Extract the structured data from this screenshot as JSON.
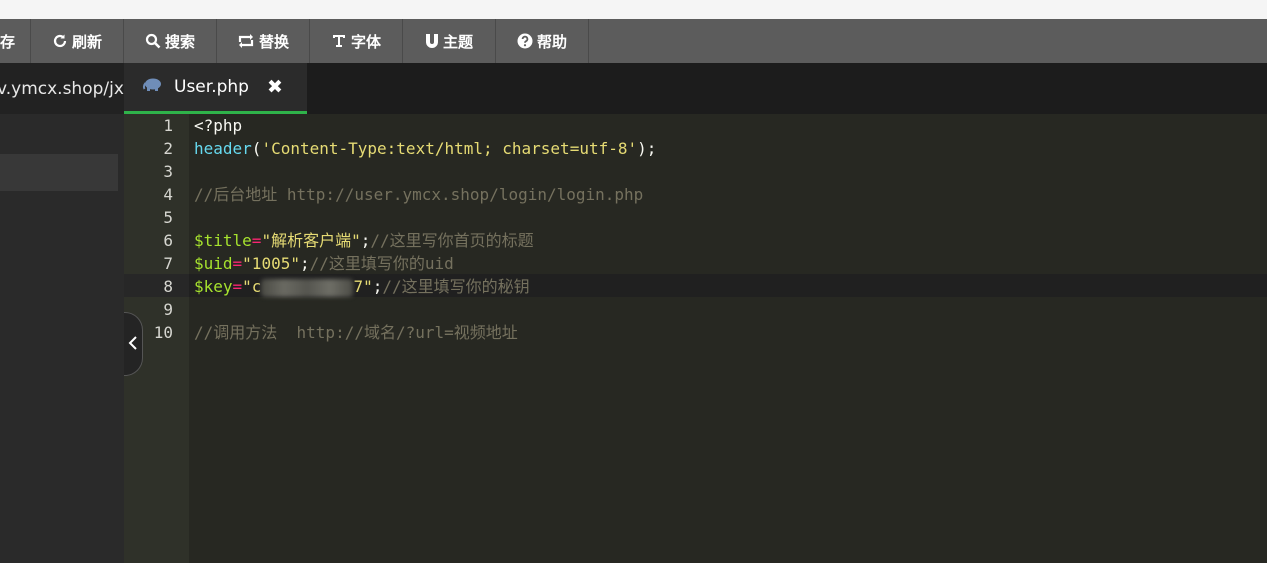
{
  "toolbar": {
    "items": [
      {
        "label": "存",
        "icon": "save-icon"
      },
      {
        "label": "刷新",
        "icon": "refresh-icon"
      },
      {
        "label": "搜索",
        "icon": "search-icon"
      },
      {
        "label": "替换",
        "icon": "replace-icon"
      },
      {
        "label": "字体",
        "icon": "font-icon"
      },
      {
        "label": "主题",
        "icon": "theme-icon"
      },
      {
        "label": "帮助",
        "icon": "help-icon"
      }
    ]
  },
  "tabs": [
    {
      "label": "v.ymcx.shop/jx",
      "active": false
    },
    {
      "label": "User.php",
      "active": true,
      "icon": "php-elephant-icon"
    }
  ],
  "editor": {
    "active_line": 8,
    "lines": [
      {
        "number": "1",
        "tokens": [
          {
            "t": "<?php",
            "c": "plain"
          }
        ]
      },
      {
        "number": "2",
        "tokens": [
          {
            "t": "header",
            "c": "func"
          },
          {
            "t": "(",
            "c": "plain"
          },
          {
            "t": "'Content-Type:text/html; charset=utf-8'",
            "c": "str"
          },
          {
            "t": ");",
            "c": "plain"
          }
        ]
      },
      {
        "number": "3",
        "tokens": []
      },
      {
        "number": "4",
        "tokens": [
          {
            "t": "//后台地址 http://user.ymcx.shop/login/login.php",
            "c": "comment"
          }
        ]
      },
      {
        "number": "5",
        "tokens": []
      },
      {
        "number": "6",
        "tokens": [
          {
            "t": "$title",
            "c": "var"
          },
          {
            "t": "=",
            "c": "op"
          },
          {
            "t": "\"解析客户端\"",
            "c": "str"
          },
          {
            "t": ";",
            "c": "plain"
          },
          {
            "t": "//这里写你首页的标题",
            "c": "comment"
          }
        ]
      },
      {
        "number": "7",
        "tokens": [
          {
            "t": "$uid",
            "c": "var"
          },
          {
            "t": "=",
            "c": "op"
          },
          {
            "t": "\"1005\"",
            "c": "str"
          },
          {
            "t": ";",
            "c": "plain"
          },
          {
            "t": "//这里填写你的uid",
            "c": "comment"
          }
        ]
      },
      {
        "number": "8",
        "tokens": [
          {
            "t": "$key",
            "c": "var"
          },
          {
            "t": "=",
            "c": "op"
          },
          {
            "t": "\"c",
            "c": "str"
          },
          {
            "t": "",
            "c": "blur"
          },
          {
            "t": "7\"",
            "c": "str"
          },
          {
            "t": ";",
            "c": "plain"
          },
          {
            "t": "//这里填写你的秘钥",
            "c": "comment"
          }
        ]
      },
      {
        "number": "9",
        "tokens": []
      },
      {
        "number": "10",
        "tokens": [
          {
            "t": "//调用方法  http://域名/?url=视频地址",
            "c": "comment"
          }
        ]
      }
    ]
  }
}
